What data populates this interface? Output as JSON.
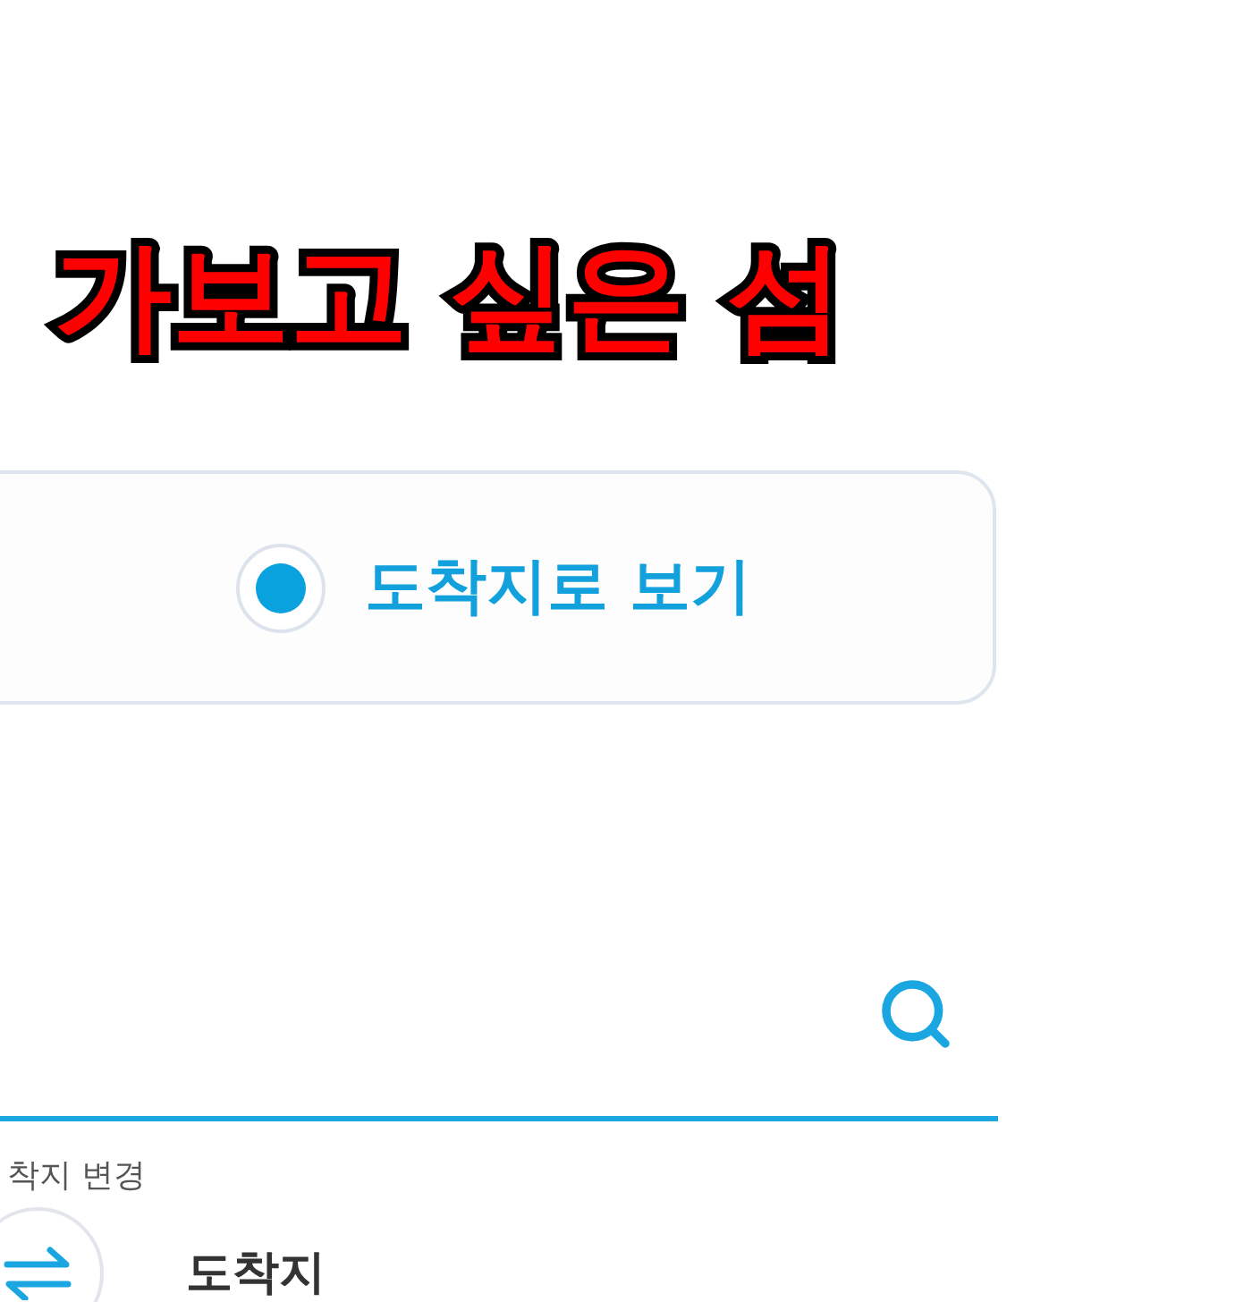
{
  "title": "가보고 싶은 섬",
  "view_options": [
    {
      "label": "도착지로 보기",
      "selected": true
    }
  ],
  "swap": {
    "label": "착지 변경"
  },
  "destination": {
    "label": "도착지"
  }
}
